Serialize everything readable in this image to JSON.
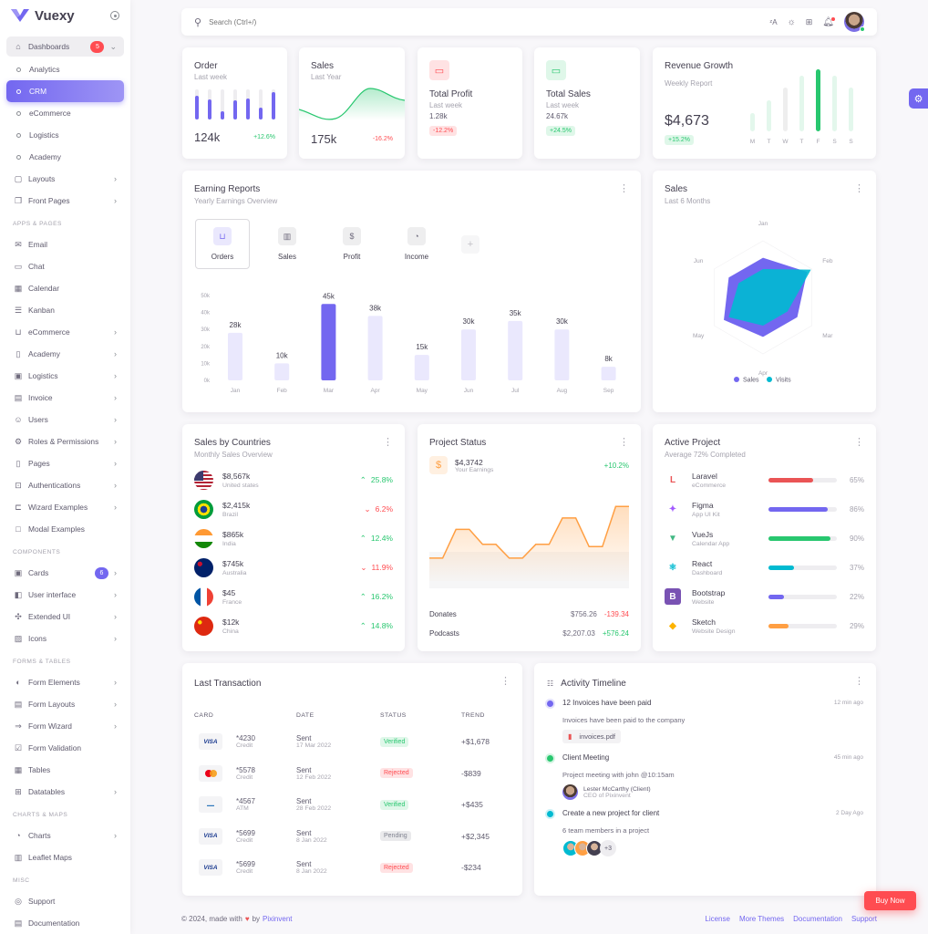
{
  "brand": {
    "name": "Vuexy"
  },
  "sidebar": {
    "dashboards": {
      "label": "Dashboards",
      "badge": "5"
    },
    "dashboard_items": [
      {
        "label": "Analytics",
        "active": false
      },
      {
        "label": "CRM",
        "active": true
      },
      {
        "label": "eCommerce",
        "active": false
      },
      {
        "label": "Logistics",
        "active": false
      },
      {
        "label": "Academy",
        "active": false
      }
    ],
    "top_items": [
      {
        "label": "Layouts",
        "icon": "layout-icon",
        "chevron": true
      },
      {
        "label": "Front Pages",
        "icon": "files-icon",
        "chevron": true
      }
    ],
    "sections": [
      {
        "title": "APPS & PAGES",
        "items": [
          {
            "label": "Email",
            "icon": "mail-icon",
            "chevron": false
          },
          {
            "label": "Chat",
            "icon": "messages-icon",
            "chevron": false
          },
          {
            "label": "Calendar",
            "icon": "calendar-icon",
            "chevron": false
          },
          {
            "label": "Kanban",
            "icon": "kanban-icon",
            "chevron": false
          },
          {
            "label": "eCommerce",
            "icon": "cart-icon",
            "chevron": true
          },
          {
            "label": "Academy",
            "icon": "book-icon",
            "chevron": true
          },
          {
            "label": "Logistics",
            "icon": "truck-icon",
            "chevron": true
          },
          {
            "label": "Invoice",
            "icon": "invoice-icon",
            "chevron": true
          },
          {
            "label": "Users",
            "icon": "users-icon",
            "chevron": true
          },
          {
            "label": "Roles & Permissions",
            "icon": "settings-icon",
            "chevron": true
          },
          {
            "label": "Pages",
            "icon": "file-icon",
            "chevron": true
          },
          {
            "label": "Authentications",
            "icon": "lock-icon",
            "chevron": true
          },
          {
            "label": "Wizard Examples",
            "icon": "wizard-icon",
            "chevron": true
          },
          {
            "label": "Modal Examples",
            "icon": "square-icon",
            "chevron": false
          }
        ]
      },
      {
        "title": "COMPONENTS",
        "items": [
          {
            "label": "Cards",
            "icon": "id-card-icon",
            "chevron": true,
            "badge": "6"
          },
          {
            "label": "User interface",
            "icon": "ui-icon",
            "chevron": true
          },
          {
            "label": "Extended UI",
            "icon": "components-icon",
            "chevron": true
          },
          {
            "label": "Icons",
            "icon": "icons-icon",
            "chevron": true
          }
        ]
      },
      {
        "title": "FORMS & TABLES",
        "items": [
          {
            "label": "Form Elements",
            "icon": "toggle-icon",
            "chevron": true
          },
          {
            "label": "Form Layouts",
            "icon": "layout-navbar-icon",
            "chevron": true
          },
          {
            "label": "Form Wizard",
            "icon": "arrows-right-icon",
            "chevron": true
          },
          {
            "label": "Form Validation",
            "icon": "checkbox-icon",
            "chevron": false
          },
          {
            "label": "Tables",
            "icon": "table-icon",
            "chevron": false
          },
          {
            "label": "Datatables",
            "icon": "grid-icon",
            "chevron": true
          }
        ]
      },
      {
        "title": "CHARTS & MAPS",
        "items": [
          {
            "label": "Charts",
            "icon": "chart-pie-icon",
            "chevron": true
          },
          {
            "label": "Leaflet Maps",
            "icon": "map-icon",
            "chevron": false
          }
        ]
      },
      {
        "title": "MISC",
        "items": [
          {
            "label": "Support",
            "icon": "lifebuoy-icon",
            "chevron": false
          },
          {
            "label": "Documentation",
            "icon": "file-description-icon",
            "chevron": false
          }
        ]
      }
    ]
  },
  "topbar": {
    "search_placeholder": "Search (Ctrl+/)"
  },
  "order_card": {
    "title": "Order",
    "subtitle": "Last week",
    "value": "124k",
    "change": "+12.6%",
    "bars": [
      0.78,
      0.67,
      0.28,
      0.63,
      0.7,
      0.4,
      0.92
    ]
  },
  "sales_card": {
    "title": "Sales",
    "subtitle": "Last Year",
    "value": "175k",
    "change": "-16.2%"
  },
  "profit_card": {
    "title": "Total Profit",
    "subtitle": "Last week",
    "value": "1.28k",
    "change": "-12.2%"
  },
  "total_sales_card": {
    "title": "Total Sales",
    "subtitle": "Last week",
    "value": "24.67k",
    "change": "+24.5%"
  },
  "revenue_card": {
    "title": "Revenue Growth",
    "subtitle": "Weekly Report",
    "value": "$4,673",
    "change": "+15.2%",
    "days": [
      "M",
      "T",
      "W",
      "T",
      "F",
      "S",
      "S"
    ],
    "values": [
      30,
      50,
      70,
      90,
      100,
      90,
      70
    ],
    "highlight_index": 4
  },
  "earning_reports": {
    "title": "Earning Reports",
    "subtitle": "Yearly Earnings Overview",
    "tabs": [
      {
        "label": "Orders",
        "icon": "cart-icon",
        "active": true
      },
      {
        "label": "Sales",
        "icon": "chart-bar-icon",
        "active": false
      },
      {
        "label": "Profit",
        "icon": "dollar-icon",
        "active": false
      },
      {
        "label": "Income",
        "icon": "chart-pie-icon",
        "active": false
      }
    ]
  },
  "sales_radar": {
    "title": "Sales",
    "subtitle": "Last 6 Months"
  },
  "sales_by_countries": {
    "title": "Sales by Countries",
    "subtitle": "Monthly Sales Overview",
    "rows": [
      {
        "value": "$8,567k",
        "country": "United states",
        "change": "25.8%",
        "up": true,
        "flag": "us"
      },
      {
        "value": "$2,415k",
        "country": "Brazil",
        "change": "6.2%",
        "up": false,
        "flag": "br"
      },
      {
        "value": "$865k",
        "country": "India",
        "change": "12.4%",
        "up": true,
        "flag": "in"
      },
      {
        "value": "$745k",
        "country": "Australia",
        "change": "11.9%",
        "up": false,
        "flag": "au"
      },
      {
        "value": "$45",
        "country": "France",
        "change": "16.2%",
        "up": true,
        "flag": "fr"
      },
      {
        "value": "$12k",
        "country": "China",
        "change": "14.8%",
        "up": true,
        "flag": "cn"
      }
    ]
  },
  "project_status": {
    "title": "Project Status",
    "earnings_value": "$4,3742",
    "earnings_label": "Your Earnings",
    "earnings_change": "+10.2%",
    "line": [
      20,
      20,
      45,
      45,
      32,
      32,
      20,
      20,
      32,
      32,
      55,
      55,
      30,
      30,
      65,
      65
    ],
    "rows": [
      {
        "label": "Donates",
        "value": "$756.26",
        "change": "-139.34",
        "up": false
      },
      {
        "label": "Podcasts",
        "value": "$2,207.03",
        "change": "+576.24",
        "up": true
      }
    ]
  },
  "active_project": {
    "title": "Active Project",
    "subtitle": "Average 72% Completed",
    "rows": [
      {
        "name": "Laravel",
        "sub": "eCommerce",
        "pct": 65,
        "pct_label": "65%",
        "color": "#ea5455",
        "logo": "laravel"
      },
      {
        "name": "Figma",
        "sub": "App UI Kit",
        "pct": 86,
        "pct_label": "86%",
        "color": "#7367f0",
        "logo": "figma"
      },
      {
        "name": "VueJs",
        "sub": "Calendar App",
        "pct": 90,
        "pct_label": "90%",
        "color": "#28c76f",
        "logo": "vue"
      },
      {
        "name": "React",
        "sub": "Dashboard",
        "pct": 37,
        "pct_label": "37%",
        "color": "#00bad1",
        "logo": "react"
      },
      {
        "name": "Bootstrap",
        "sub": "Website",
        "pct": 22,
        "pct_label": "22%",
        "color": "#7367f0",
        "logo": "bootstrap"
      },
      {
        "name": "Sketch",
        "sub": "Website Design",
        "pct": 29,
        "pct_label": "29%",
        "color": "#ff9f43",
        "logo": "sketch"
      }
    ]
  },
  "last_transaction": {
    "title": "Last Transaction",
    "headers": [
      "CARD",
      "DATE",
      "STATUS",
      "TREND"
    ],
    "rows": [
      {
        "brand": "visa",
        "number": "*4230",
        "type": "Credit",
        "sent": "Sent",
        "date": "17 Mar 2022",
        "status": "Verified",
        "trend": "+$1,678"
      },
      {
        "brand": "mastercard",
        "number": "*5578",
        "type": "Credit",
        "sent": "Sent",
        "date": "12 Feb 2022",
        "status": "Rejected",
        "trend": "-$839"
      },
      {
        "brand": "amex",
        "number": "*4567",
        "type": "ATM",
        "sent": "Sent",
        "date": "28 Feb 2022",
        "status": "Verified",
        "trend": "+$435"
      },
      {
        "brand": "visa",
        "number": "*5699",
        "type": "Credit",
        "sent": "Sent",
        "date": "8 Jan 2022",
        "status": "Pending",
        "trend": "+$2,345"
      },
      {
        "brand": "visa",
        "number": "*5699",
        "type": "Credit",
        "sent": "Sent",
        "date": "8 Jan 2022",
        "status": "Rejected",
        "trend": "-$234"
      }
    ]
  },
  "activity_timeline": {
    "title": "Activity Timeline",
    "items": [
      {
        "title": "12 Invoices have been paid",
        "time": "12 min ago",
        "desc": "Invoices have been paid to the company",
        "file": "invoices.pdf",
        "color": "#7367f0"
      },
      {
        "title": "Client Meeting",
        "time": "45 min ago",
        "desc": "Project meeting with john @10:15am",
        "person": "Lester McCarthy (Client)",
        "person_role": "CEO of Pixinvent",
        "color": "#28c76f"
      },
      {
        "title": "Create a new project for client",
        "time": "2 Day Ago",
        "desc": "6 team members in a project",
        "extra_count": "+3",
        "color": "#00bad1"
      }
    ]
  },
  "footer": {
    "copyright": "© 2024, made with",
    "by": "by",
    "company": "Pixinvent",
    "links": [
      "License",
      "More Themes",
      "Documentation",
      "Support"
    ]
  },
  "buy_now": "Buy Now",
  "chart_data": [
    {
      "type": "bar",
      "title": "Earning Reports",
      "categories": [
        "Jan",
        "Feb",
        "Mar",
        "Apr",
        "May",
        "Jun",
        "Jul",
        "Aug",
        "Sep"
      ],
      "values": [
        28,
        10,
        45,
        38,
        15,
        30,
        35,
        30,
        8
      ],
      "data_labels": [
        "28k",
        "10k",
        "45k",
        "38k",
        "15k",
        "30k",
        "35k",
        "30k",
        "8k"
      ],
      "yticks": [
        "0k",
        "10k",
        "20k",
        "30k",
        "40k",
        "50k"
      ],
      "ylim": [
        0,
        50
      ],
      "highlight": "Mar",
      "colors": {
        "normal": "#eae8fd",
        "highlight": "#7367f0"
      }
    },
    {
      "type": "radar",
      "title": "Sales",
      "categories": [
        "Jan",
        "Feb",
        "Mar",
        "Apr",
        "May",
        "Jun"
      ],
      "series": [
        {
          "name": "Sales",
          "values": [
            70,
            90,
            70,
            70,
            80,
            70
          ],
          "color": "#7367f0"
        },
        {
          "name": "Visits",
          "values": [
            50,
            98,
            50,
            50,
            70,
            50
          ],
          "color": "#00bad1"
        }
      ],
      "legend": "bottom"
    }
  ]
}
